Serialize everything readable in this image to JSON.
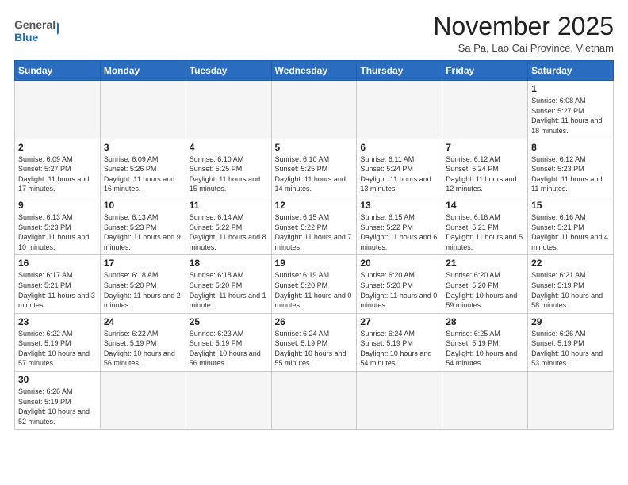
{
  "header": {
    "logo_general": "General",
    "logo_blue": "Blue",
    "month_title": "November 2025",
    "location": "Sa Pa, Lao Cai Province, Vietnam"
  },
  "weekdays": [
    "Sunday",
    "Monday",
    "Tuesday",
    "Wednesday",
    "Thursday",
    "Friday",
    "Saturday"
  ],
  "weeks": [
    [
      {
        "day": "",
        "info": "",
        "empty": true
      },
      {
        "day": "",
        "info": "",
        "empty": true
      },
      {
        "day": "",
        "info": "",
        "empty": true
      },
      {
        "day": "",
        "info": "",
        "empty": true
      },
      {
        "day": "",
        "info": "",
        "empty": true
      },
      {
        "day": "",
        "info": "",
        "empty": true
      },
      {
        "day": "1",
        "info": "Sunrise: 6:08 AM\nSunset: 5:27 PM\nDaylight: 11 hours and 18 minutes."
      }
    ],
    [
      {
        "day": "2",
        "info": "Sunrise: 6:09 AM\nSunset: 5:27 PM\nDaylight: 11 hours and 17 minutes."
      },
      {
        "day": "3",
        "info": "Sunrise: 6:09 AM\nSunset: 5:26 PM\nDaylight: 11 hours and 16 minutes."
      },
      {
        "day": "4",
        "info": "Sunrise: 6:10 AM\nSunset: 5:25 PM\nDaylight: 11 hours and 15 minutes."
      },
      {
        "day": "5",
        "info": "Sunrise: 6:10 AM\nSunset: 5:25 PM\nDaylight: 11 hours and 14 minutes."
      },
      {
        "day": "6",
        "info": "Sunrise: 6:11 AM\nSunset: 5:24 PM\nDaylight: 11 hours and 13 minutes."
      },
      {
        "day": "7",
        "info": "Sunrise: 6:12 AM\nSunset: 5:24 PM\nDaylight: 11 hours and 12 minutes."
      },
      {
        "day": "8",
        "info": "Sunrise: 6:12 AM\nSunset: 5:23 PM\nDaylight: 11 hours and 11 minutes."
      }
    ],
    [
      {
        "day": "9",
        "info": "Sunrise: 6:13 AM\nSunset: 5:23 PM\nDaylight: 11 hours and 10 minutes."
      },
      {
        "day": "10",
        "info": "Sunrise: 6:13 AM\nSunset: 5:23 PM\nDaylight: 11 hours and 9 minutes."
      },
      {
        "day": "11",
        "info": "Sunrise: 6:14 AM\nSunset: 5:22 PM\nDaylight: 11 hours and 8 minutes."
      },
      {
        "day": "12",
        "info": "Sunrise: 6:15 AM\nSunset: 5:22 PM\nDaylight: 11 hours and 7 minutes."
      },
      {
        "day": "13",
        "info": "Sunrise: 6:15 AM\nSunset: 5:22 PM\nDaylight: 11 hours and 6 minutes."
      },
      {
        "day": "14",
        "info": "Sunrise: 6:16 AM\nSunset: 5:21 PM\nDaylight: 11 hours and 5 minutes."
      },
      {
        "day": "15",
        "info": "Sunrise: 6:16 AM\nSunset: 5:21 PM\nDaylight: 11 hours and 4 minutes."
      }
    ],
    [
      {
        "day": "16",
        "info": "Sunrise: 6:17 AM\nSunset: 5:21 PM\nDaylight: 11 hours and 3 minutes."
      },
      {
        "day": "17",
        "info": "Sunrise: 6:18 AM\nSunset: 5:20 PM\nDaylight: 11 hours and 2 minutes."
      },
      {
        "day": "18",
        "info": "Sunrise: 6:18 AM\nSunset: 5:20 PM\nDaylight: 11 hours and 1 minute."
      },
      {
        "day": "19",
        "info": "Sunrise: 6:19 AM\nSunset: 5:20 PM\nDaylight: 11 hours and 0 minutes."
      },
      {
        "day": "20",
        "info": "Sunrise: 6:20 AM\nSunset: 5:20 PM\nDaylight: 11 hours and 0 minutes."
      },
      {
        "day": "21",
        "info": "Sunrise: 6:20 AM\nSunset: 5:20 PM\nDaylight: 10 hours and 59 minutes."
      },
      {
        "day": "22",
        "info": "Sunrise: 6:21 AM\nSunset: 5:19 PM\nDaylight: 10 hours and 58 minutes."
      }
    ],
    [
      {
        "day": "23",
        "info": "Sunrise: 6:22 AM\nSunset: 5:19 PM\nDaylight: 10 hours and 57 minutes."
      },
      {
        "day": "24",
        "info": "Sunrise: 6:22 AM\nSunset: 5:19 PM\nDaylight: 10 hours and 56 minutes."
      },
      {
        "day": "25",
        "info": "Sunrise: 6:23 AM\nSunset: 5:19 PM\nDaylight: 10 hours and 56 minutes."
      },
      {
        "day": "26",
        "info": "Sunrise: 6:24 AM\nSunset: 5:19 PM\nDaylight: 10 hours and 55 minutes."
      },
      {
        "day": "27",
        "info": "Sunrise: 6:24 AM\nSunset: 5:19 PM\nDaylight: 10 hours and 54 minutes."
      },
      {
        "day": "28",
        "info": "Sunrise: 6:25 AM\nSunset: 5:19 PM\nDaylight: 10 hours and 54 minutes."
      },
      {
        "day": "29",
        "info": "Sunrise: 6:26 AM\nSunset: 5:19 PM\nDaylight: 10 hours and 53 minutes."
      }
    ],
    [
      {
        "day": "30",
        "info": "Sunrise: 6:26 AM\nSunset: 5:19 PM\nDaylight: 10 hours and 52 minutes."
      },
      {
        "day": "",
        "info": "",
        "empty": true
      },
      {
        "day": "",
        "info": "",
        "empty": true
      },
      {
        "day": "",
        "info": "",
        "empty": true
      },
      {
        "day": "",
        "info": "",
        "empty": true
      },
      {
        "day": "",
        "info": "",
        "empty": true
      },
      {
        "day": "",
        "info": "",
        "empty": true
      }
    ]
  ]
}
